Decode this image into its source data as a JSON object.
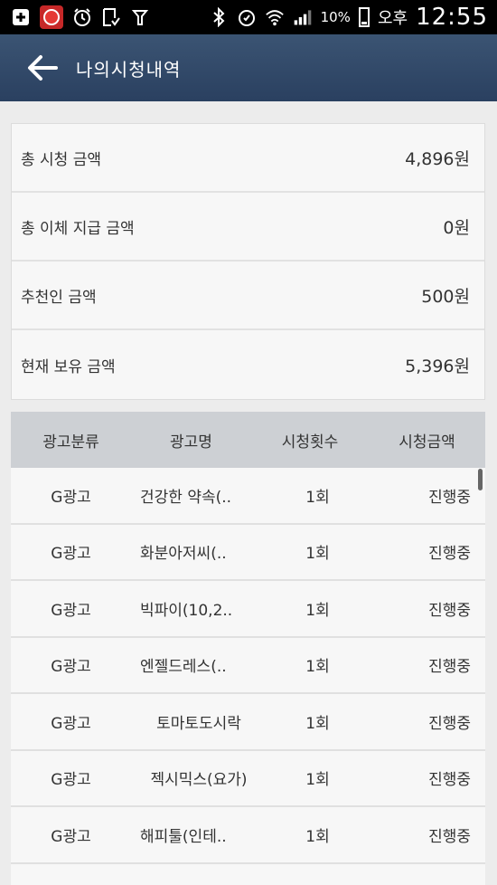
{
  "status_bar": {
    "battery_percent": "10%",
    "ampm": "오후",
    "time": "12:55"
  },
  "app_bar": {
    "title": "나의시청내역"
  },
  "summary": [
    {
      "label": "총 시청 금액",
      "value": "4,896원"
    },
    {
      "label": "총 이체 지급 금액",
      "value": "0원"
    },
    {
      "label": "추천인 금액",
      "value": "500원"
    },
    {
      "label": "현재 보유 금액",
      "value": "5,396원"
    }
  ],
  "table": {
    "headers": [
      "광고분류",
      "광고명",
      "시청횟수",
      "시청금액"
    ],
    "rows": [
      {
        "category": "G광고",
        "name": "건강한 약속(..",
        "count": "1회",
        "amount": "진행중"
      },
      {
        "category": "G광고",
        "name": "화분아저씨(..",
        "count": "1회",
        "amount": "진행중"
      },
      {
        "category": "G광고",
        "name": "빅파이(10,2..",
        "count": "1회",
        "amount": "진행중"
      },
      {
        "category": "G광고",
        "name": "엔젤드레스(..",
        "count": "1회",
        "amount": "진행중"
      },
      {
        "category": "G광고",
        "name": "토마토도시락",
        "count": "1회",
        "amount": "진행중"
      },
      {
        "category": "G광고",
        "name": "젝시믹스(요가)",
        "count": "1회",
        "amount": "진행중"
      },
      {
        "category": "G광고",
        "name": "해피툴(인테..",
        "count": "1회",
        "amount": "진행중"
      }
    ]
  }
}
